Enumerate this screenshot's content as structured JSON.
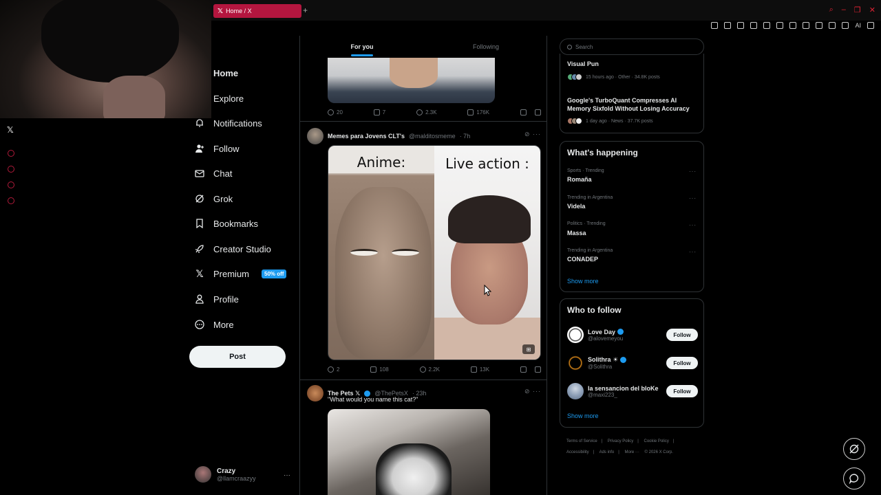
{
  "browser": {
    "tab_title": "Home / X",
    "new_tab": "+",
    "toolbar_ai": "AI"
  },
  "nav": {
    "items": [
      {
        "label": "Home",
        "icon": "home-icon"
      },
      {
        "label": "Explore",
        "icon": "search-icon"
      },
      {
        "label": "Notifications",
        "icon": "bell-icon"
      },
      {
        "label": "Follow",
        "icon": "follow-icon"
      },
      {
        "label": "Chat",
        "icon": "mail-icon"
      },
      {
        "label": "Grok",
        "icon": "grok-icon"
      },
      {
        "label": "Bookmarks",
        "icon": "bookmark-icon"
      },
      {
        "label": "Creator Studio",
        "icon": "rocket-icon"
      },
      {
        "label": "Premium",
        "icon": "x-logo-icon",
        "badge": "50% off"
      },
      {
        "label": "Profile",
        "icon": "person-icon"
      },
      {
        "label": "More",
        "icon": "more-circle-icon"
      }
    ],
    "post_button": "Post",
    "account": {
      "name": "Crazy",
      "handle": "@llamcraazyy",
      "more": "···"
    }
  },
  "timeline": {
    "tabs": [
      "For you",
      "Following"
    ],
    "active_tab": "For you",
    "posts": [
      {
        "stats": {
          "replies": "20",
          "reposts": "7",
          "likes": "2.3K",
          "views": "176K"
        }
      },
      {
        "name": "Memes para Jovens CLT's",
        "handle": "@malditosmeme",
        "time": "· 7h",
        "meme_left": "Anime:",
        "meme_right": "Live action :",
        "stats": {
          "replies": "2",
          "reposts": "108",
          "likes": "2.2K",
          "views": "13K"
        }
      },
      {
        "name": "The Pets 𝕏",
        "handle": "@ThePetsX",
        "time": "· 23h",
        "text": "\"What would you name this cat?\""
      }
    ]
  },
  "right": {
    "search_placeholder": "Search",
    "news": [
      {
        "title": "Visual Pun",
        "meta": "15 hours ago · Other · 34.8K posts"
      },
      {
        "title": "Google's TurboQuant Compresses AI Memory Sixfold Without Losing Accuracy",
        "meta": "1 day ago · News · 37.7K posts"
      }
    ],
    "happening": {
      "title": "What's happening",
      "trends": [
        {
          "context": "Sports · Trending",
          "name": "Romaña"
        },
        {
          "context": "Trending in Argentina",
          "name": "Videla"
        },
        {
          "context": "Politics · Trending",
          "name": "Massa"
        },
        {
          "context": "Trending in Argentina",
          "name": "CONADEP"
        }
      ],
      "show_more": "Show more"
    },
    "who_to_follow": {
      "title": "Who to follow",
      "accounts": [
        {
          "name": "Love Day",
          "handle": "@alovemeyou",
          "button": "Follow"
        },
        {
          "name": "Solithra ☀",
          "handle": "@Solithra",
          "button": "Follow"
        },
        {
          "name": "la sensancion del bloKe",
          "handle": "@maxi223_",
          "button": "Follow"
        }
      ],
      "show_more": "Show more"
    },
    "footer": [
      "Terms of Service",
      "|",
      "Privacy Policy",
      "|",
      "Cookie Policy",
      "|",
      "Accessibility",
      "|",
      "Ads info",
      "|",
      "More ···",
      "© 2026 X Corp."
    ]
  }
}
